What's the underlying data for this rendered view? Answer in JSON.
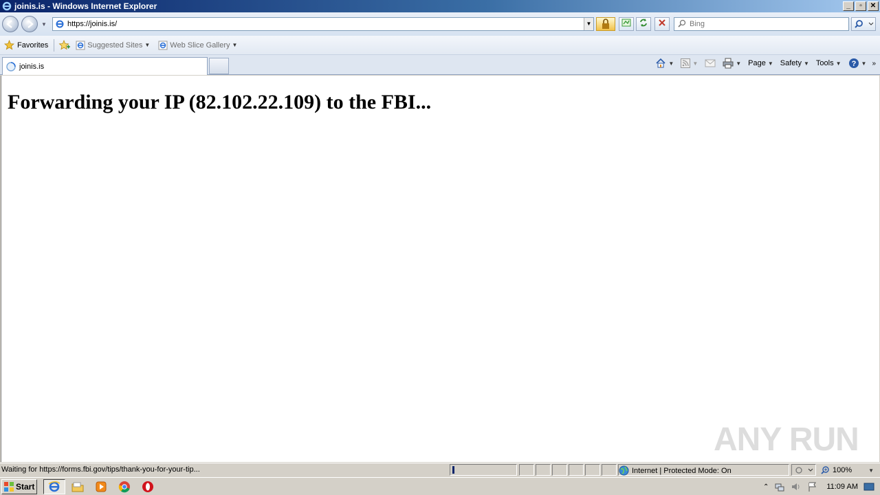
{
  "window": {
    "title": "joinis.is - Windows Internet Explorer"
  },
  "address": {
    "url": "https://joinis.is/"
  },
  "search": {
    "placeholder": "Bing"
  },
  "favorites": {
    "label": "Favorites",
    "links": [
      {
        "label": "Suggested Sites"
      },
      {
        "label": "Web Slice Gallery"
      }
    ]
  },
  "tab": {
    "title": "joinis.is"
  },
  "commandbar": {
    "page": "Page",
    "safety": "Safety",
    "tools": "Tools"
  },
  "page": {
    "heading": "Forwarding your IP (82.102.22.109) to the FBI..."
  },
  "statusbar": {
    "text": "Waiting for https://forms.fbi.gov/tips/thank-you-for-your-tip...",
    "zone": "Internet | Protected Mode: On",
    "zoom": "100%"
  },
  "watermark": {
    "text": "ANY RUN"
  },
  "taskbar": {
    "start": "Start",
    "clock": "11:09 AM"
  }
}
